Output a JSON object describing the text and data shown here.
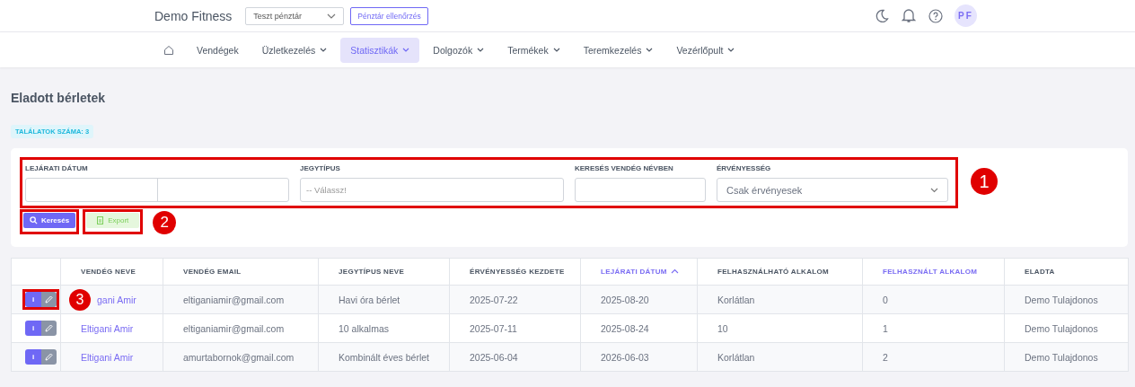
{
  "topbar": {
    "brand": "Demo Fitness",
    "register_select": "Teszt pénztár",
    "check_button": "Pénztár ellenőrzés",
    "avatar": "PF"
  },
  "nav": [
    {
      "kind": "home",
      "selected": false
    },
    {
      "label": "Vendégek",
      "dropdown": false,
      "selected": false
    },
    {
      "label": "Üzletkezelés",
      "dropdown": true,
      "selected": false
    },
    {
      "label": "Statisztikák",
      "dropdown": true,
      "selected": true
    },
    {
      "label": "Dolgozók",
      "dropdown": true,
      "selected": false
    },
    {
      "label": "Termékek",
      "dropdown": true,
      "selected": false
    },
    {
      "label": "Teremkezelés",
      "dropdown": true,
      "selected": false
    },
    {
      "label": "Vezérlőpult",
      "dropdown": true,
      "selected": false
    }
  ],
  "page_title": "Eladott bérletek",
  "result_badge": "TALÁLATOK SZÁMA: 3",
  "filters": {
    "callout": "1",
    "fields": [
      {
        "kind": "daterange",
        "label": "LEJÁRATI DÁTUM"
      },
      {
        "kind": "select",
        "label": "JEGYTÍPUS",
        "placeholder": "-- Válassz!"
      },
      {
        "kind": "text",
        "label": "KERESÉS VENDÉG NÉVBEN"
      },
      {
        "kind": "dropdown",
        "label": "ÉRVÉNYESSÉG",
        "value": "Csak érvényesek"
      }
    ]
  },
  "buttons": {
    "callout": "2",
    "search": "Keresés",
    "export": "Export"
  },
  "table": {
    "callout": "3",
    "columns": [
      {
        "label": "VENDÉG NEVE",
        "sortable": false,
        "sorted": false
      },
      {
        "label": "VENDÉG EMAIL",
        "sortable": false,
        "sorted": false
      },
      {
        "label": "JEGYTÍPUS NEVE",
        "sortable": false,
        "sorted": false
      },
      {
        "label": "ÉRVÉNYESSÉG KEZDETE",
        "sortable": false,
        "sorted": false
      },
      {
        "label": "LEJÁRATI DÁTUM",
        "sortable": true,
        "sorted": true
      },
      {
        "label": "FELHASZNÁLHATÓ ALKALOM",
        "sortable": false,
        "sorted": false
      },
      {
        "label": "FELHASZNÁLT ALKALOM",
        "sortable": true,
        "sorted": false
      },
      {
        "label": "ELADTA",
        "sortable": false,
        "sorted": false
      }
    ],
    "rows": [
      {
        "info": "i",
        "cells": [
          "gani Amir",
          "eltiganiamir@gmail.com",
          "Havi óra bérlet",
          "2025-07-22",
          "2025-08-20",
          "Korlátlan",
          "0",
          "Demo Tulajdonos"
        ]
      },
      {
        "info": "i",
        "cells": [
          "Eltigani Amir",
          "eltiganiamir@gmail.com",
          "10 alkalmas",
          "2025-07-11",
          "2025-08-24",
          "10",
          "1",
          "Demo Tulajdonos"
        ]
      },
      {
        "info": "i",
        "cells": [
          "Eltigani Amir",
          "amurtabornok@gmail.com",
          "Kombinált éves bérlet",
          "2025-06-04",
          "2026-06-03",
          "Korlátlan",
          "2",
          "Demo Tulajdonos"
        ]
      }
    ]
  }
}
